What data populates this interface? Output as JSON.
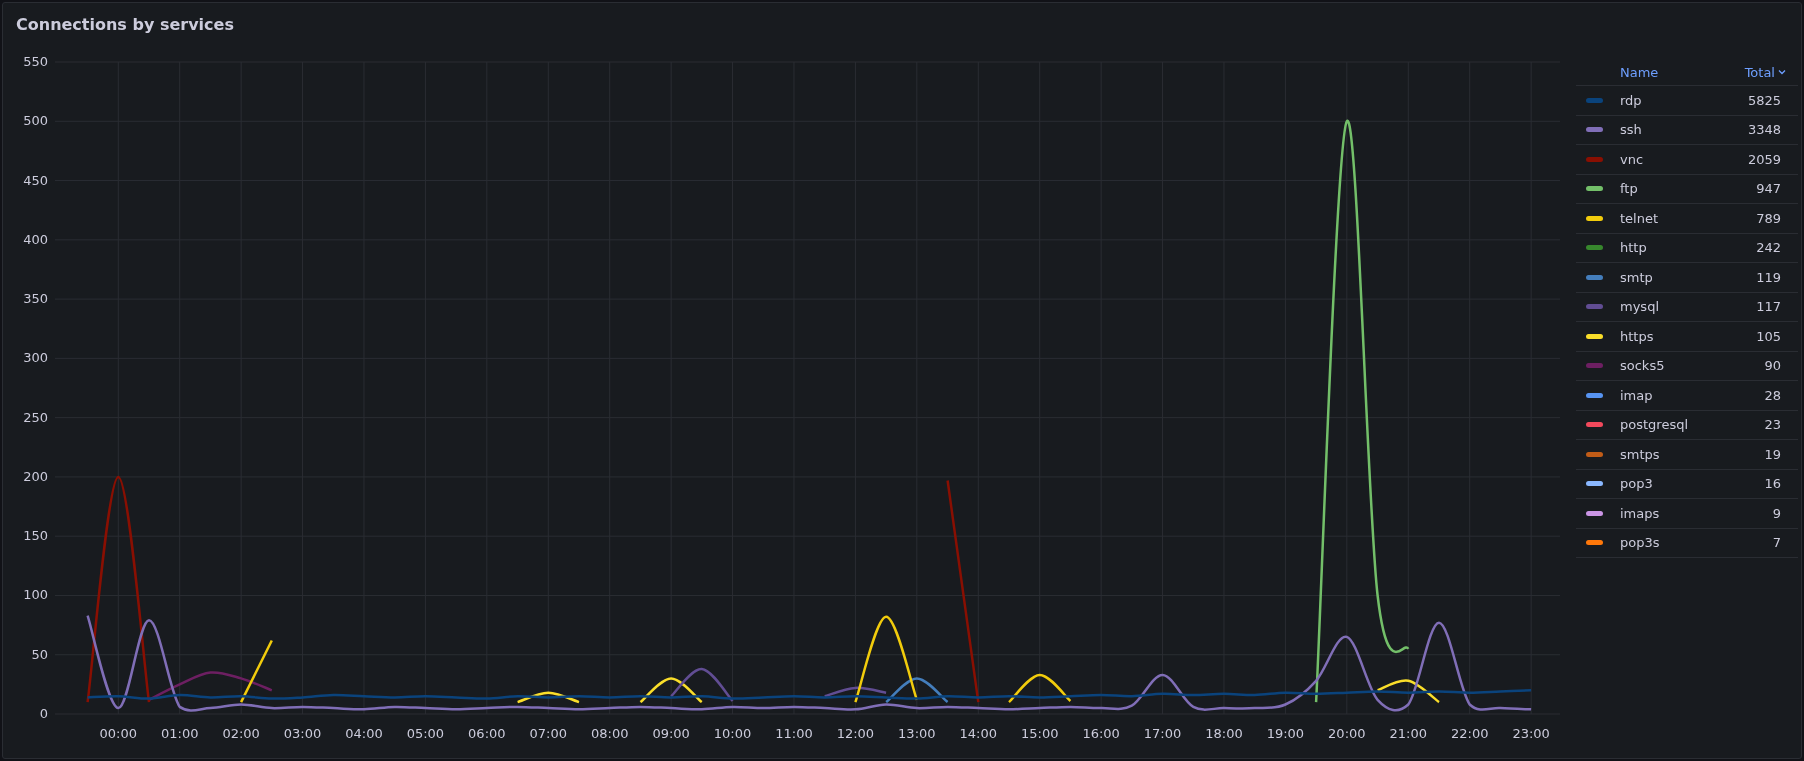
{
  "panel": {
    "title": "Connections by services"
  },
  "chart_data": {
    "type": "line",
    "grid": true,
    "x": [
      -0.5,
      0,
      0.5,
      1,
      1.5,
      2,
      2.5,
      3,
      3.5,
      4,
      4.5,
      5,
      5.5,
      6,
      6.5,
      7,
      7.5,
      8,
      8.5,
      9,
      9.5,
      10,
      10.5,
      11,
      11.5,
      12,
      12.5,
      13,
      13.5,
      14,
      14.5,
      15,
      15.5,
      16,
      16.5,
      17,
      17.5,
      18,
      18.5,
      19,
      19.5,
      20,
      20.5,
      21,
      21.5,
      22,
      22.5,
      23
    ],
    "xlim": [
      -1.03,
      23.47
    ],
    "ylim": [
      0,
      550
    ],
    "xticks": [
      {
        "value": 0,
        "label": "00:00"
      },
      {
        "value": 1,
        "label": "01:00"
      },
      {
        "value": 2,
        "label": "02:00"
      },
      {
        "value": 3,
        "label": "03:00"
      },
      {
        "value": 4,
        "label": "04:00"
      },
      {
        "value": 5,
        "label": "05:00"
      },
      {
        "value": 6,
        "label": "06:00"
      },
      {
        "value": 7,
        "label": "07:00"
      },
      {
        "value": 8,
        "label": "08:00"
      },
      {
        "value": 9,
        "label": "09:00"
      },
      {
        "value": 10,
        "label": "10:00"
      },
      {
        "value": 11,
        "label": "11:00"
      },
      {
        "value": 12,
        "label": "12:00"
      },
      {
        "value": 13,
        "label": "13:00"
      },
      {
        "value": 14,
        "label": "14:00"
      },
      {
        "value": 15,
        "label": "15:00"
      },
      {
        "value": 16,
        "label": "16:00"
      },
      {
        "value": 17,
        "label": "17:00"
      },
      {
        "value": 18,
        "label": "18:00"
      },
      {
        "value": 19,
        "label": "19:00"
      },
      {
        "value": 20,
        "label": "20:00"
      },
      {
        "value": 21,
        "label": "21:00"
      },
      {
        "value": 22,
        "label": "22:00"
      },
      {
        "value": 23,
        "label": "23:00"
      }
    ],
    "yticks": [
      0,
      50,
      100,
      150,
      200,
      250,
      300,
      350,
      400,
      450,
      500,
      550
    ],
    "series": [
      {
        "name": "rdp",
        "color": "#0a437c",
        "values": [
          14,
          15,
          13,
          16,
          14,
          15,
          13,
          14,
          16,
          15,
          14,
          15,
          14,
          13,
          15,
          14,
          15,
          14,
          15,
          14,
          15,
          13,
          14,
          15,
          14,
          15,
          14,
          13,
          15,
          14,
          15,
          14,
          15,
          16,
          15,
          17,
          16,
          17,
          16,
          18,
          17,
          18,
          19,
          18,
          19,
          18,
          19,
          20
        ]
      },
      {
        "name": "ssh",
        "color": "#806eb7",
        "values": [
          83,
          5,
          79,
          6,
          5,
          8,
          5,
          6,
          5,
          4,
          6,
          5,
          4,
          5,
          6,
          5,
          4,
          5,
          6,
          5,
          4,
          6,
          5,
          6,
          5,
          4,
          8,
          5,
          6,
          5,
          4,
          5,
          6,
          5,
          7,
          33,
          6,
          5,
          5,
          8,
          28,
          65,
          12,
          8,
          77,
          8,
          5,
          4
        ]
      },
      {
        "name": "vnc",
        "color": "#890f02",
        "values": [
          10,
          200,
          10,
          null,
          null,
          null,
          null,
          null,
          null,
          null,
          null,
          null,
          null,
          null,
          null,
          null,
          null,
          null,
          null,
          null,
          null,
          null,
          null,
          null,
          null,
          null,
          null,
          null,
          197,
          10,
          null,
          null,
          null,
          null,
          null,
          null,
          null,
          null,
          null,
          null,
          null,
          null,
          null,
          null,
          null,
          null,
          null,
          null
        ]
      },
      {
        "name": "ftp",
        "color": "#73bf69",
        "values": [
          null,
          null,
          null,
          null,
          null,
          null,
          null,
          null,
          null,
          null,
          null,
          null,
          null,
          null,
          null,
          null,
          null,
          null,
          null,
          null,
          null,
          null,
          null,
          null,
          null,
          null,
          null,
          null,
          null,
          null,
          null,
          null,
          null,
          null,
          null,
          null,
          null,
          null,
          null,
          null,
          10,
          500,
          100,
          55,
          null,
          null,
          null,
          null
        ]
      },
      {
        "name": "telnet",
        "color": "#f2cc0c",
        "values": [
          null,
          null,
          null,
          null,
          null,
          10,
          62,
          null,
          null,
          null,
          null,
          null,
          null,
          null,
          null,
          null,
          null,
          null,
          null,
          null,
          null,
          null,
          null,
          null,
          null,
          10,
          82,
          12,
          null,
          null,
          10,
          33,
          11,
          null,
          null,
          null,
          null,
          null,
          null,
          null,
          null,
          null,
          null,
          null,
          null,
          null,
          null,
          null
        ]
      },
      {
        "name": "http",
        "color": "#37872d",
        "values": [
          null,
          null,
          null,
          null,
          null,
          null,
          null,
          null,
          null,
          null,
          null,
          null,
          null,
          null,
          null,
          null,
          null,
          null,
          null,
          null,
          null,
          null,
          null,
          null,
          null,
          null,
          null,
          null,
          null,
          null,
          null,
          null,
          null,
          null,
          null,
          null,
          null,
          null,
          null,
          null,
          null,
          null,
          null,
          null,
          null,
          null,
          null,
          null
        ]
      },
      {
        "name": "smtp",
        "color": "#447ebc",
        "values": [
          null,
          null,
          null,
          null,
          null,
          null,
          null,
          null,
          null,
          null,
          null,
          null,
          null,
          null,
          null,
          null,
          null,
          null,
          null,
          null,
          null,
          null,
          null,
          null,
          null,
          null,
          10,
          30,
          10,
          null,
          null,
          null,
          null,
          null,
          null,
          null,
          null,
          null,
          null,
          null,
          null,
          null,
          null,
          null,
          null,
          null,
          null,
          null
        ]
      },
      {
        "name": "mysql",
        "color": "#614d93",
        "values": [
          null,
          null,
          null,
          null,
          null,
          null,
          null,
          null,
          null,
          null,
          null,
          null,
          null,
          null,
          null,
          null,
          null,
          null,
          null,
          15,
          38,
          11,
          null,
          null,
          15,
          22,
          18,
          null,
          null,
          null,
          null,
          null,
          null,
          null,
          null,
          null,
          null,
          null,
          null,
          null,
          null,
          null,
          null,
          null,
          null,
          null,
          null,
          null
        ]
      },
      {
        "name": "https",
        "color": "#fade2a",
        "values": [
          null,
          null,
          null,
          null,
          null,
          null,
          null,
          null,
          null,
          null,
          null,
          null,
          null,
          null,
          10,
          18,
          10,
          null,
          10,
          30,
          10,
          null,
          null,
          null,
          null,
          null,
          null,
          null,
          null,
          null,
          null,
          null,
          null,
          null,
          null,
          null,
          null,
          null,
          null,
          null,
          null,
          null,
          20,
          28,
          10,
          null,
          null,
          null
        ]
      },
      {
        "name": "socks5",
        "color": "#6d1f62",
        "values": [
          null,
          null,
          12,
          25,
          35,
          30,
          20,
          null,
          null,
          null,
          null,
          null,
          null,
          null,
          null,
          null,
          null,
          null,
          null,
          null,
          null,
          null,
          null,
          null,
          null,
          null,
          null,
          null,
          null,
          null,
          null,
          null,
          null,
          null,
          null,
          null,
          null,
          null,
          null,
          null,
          null,
          null,
          null,
          null,
          null,
          null,
          null,
          null
        ]
      },
      {
        "name": "imap",
        "color": "#5794f2",
        "values": [
          null,
          null,
          null,
          null,
          null,
          null,
          null,
          null,
          null,
          null,
          null,
          null,
          null,
          null,
          null,
          null,
          null,
          null,
          null,
          null,
          null,
          null,
          null,
          null,
          null,
          null,
          null,
          null,
          null,
          null,
          null,
          null,
          null,
          null,
          null,
          null,
          null,
          null,
          null,
          null,
          null,
          null,
          null,
          null,
          null,
          null,
          null,
          null
        ]
      },
      {
        "name": "postgresql",
        "color": "#f2495c",
        "values": [
          null,
          null,
          null,
          null,
          null,
          null,
          null,
          null,
          null,
          null,
          null,
          null,
          null,
          null,
          null,
          null,
          null,
          null,
          null,
          null,
          null,
          null,
          null,
          null,
          null,
          null,
          null,
          null,
          null,
          null,
          null,
          null,
          null,
          null,
          null,
          null,
          null,
          null,
          null,
          null,
          null,
          null,
          null,
          null,
          null,
          null,
          null,
          null
        ]
      },
      {
        "name": "smtps",
        "color": "#c15c17",
        "values": [
          null,
          null,
          null,
          null,
          null,
          null,
          null,
          null,
          null,
          null,
          null,
          null,
          null,
          null,
          null,
          null,
          null,
          null,
          null,
          null,
          null,
          null,
          null,
          null,
          null,
          null,
          null,
          null,
          null,
          null,
          null,
          null,
          null,
          null,
          null,
          null,
          null,
          null,
          null,
          null,
          null,
          null,
          null,
          null,
          null,
          null,
          null,
          null
        ]
      },
      {
        "name": "pop3",
        "color": "#8ab8ff",
        "values": [
          null,
          null,
          null,
          null,
          null,
          null,
          null,
          null,
          null,
          null,
          null,
          null,
          null,
          null,
          null,
          null,
          null,
          null,
          null,
          null,
          null,
          null,
          null,
          null,
          null,
          null,
          null,
          null,
          null,
          null,
          null,
          null,
          null,
          null,
          null,
          null,
          null,
          null,
          null,
          null,
          null,
          null,
          null,
          null,
          null,
          null,
          null,
          null
        ]
      },
      {
        "name": "imaps",
        "color": "#ca95e5",
        "values": [
          null,
          null,
          null,
          null,
          null,
          null,
          null,
          null,
          null,
          null,
          null,
          null,
          null,
          null,
          null,
          null,
          null,
          null,
          null,
          null,
          null,
          null,
          null,
          null,
          null,
          null,
          null,
          null,
          null,
          null,
          null,
          null,
          null,
          null,
          null,
          null,
          null,
          null,
          null,
          null,
          null,
          null,
          null,
          null,
          null,
          null,
          null,
          null
        ]
      },
      {
        "name": "pop3s",
        "color": "#ff780a",
        "values": [
          null,
          null,
          null,
          null,
          null,
          null,
          null,
          null,
          null,
          null,
          null,
          null,
          null,
          null,
          null,
          null,
          null,
          null,
          null,
          null,
          null,
          null,
          null,
          null,
          null,
          null,
          null,
          null,
          null,
          null,
          null,
          null,
          null,
          null,
          null,
          null,
          null,
          null,
          null,
          null,
          null,
          null,
          null,
          null,
          null,
          null,
          null,
          null
        ]
      }
    ]
  },
  "legend": {
    "columns": [
      "Name",
      "Total"
    ],
    "totals": [
      "5825",
      "3348",
      "2059",
      "947",
      "789",
      "242",
      "119",
      "117",
      "105",
      "90",
      "28",
      "23",
      "19",
      "16",
      "9",
      "7"
    ]
  }
}
